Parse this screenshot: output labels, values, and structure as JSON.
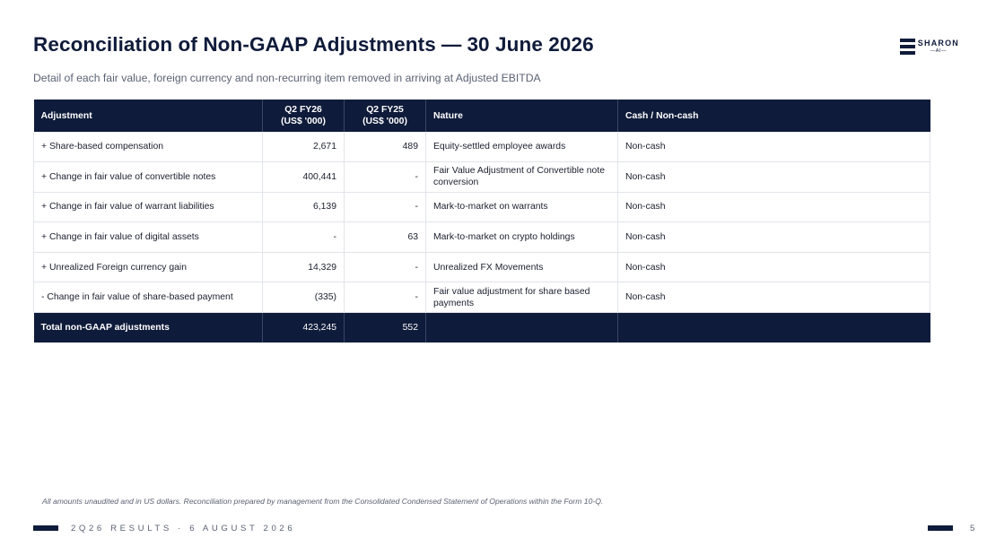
{
  "header": {
    "title_main": "Reconciliation of Non-GAAP Adjustments",
    "title_dash": "—",
    "title_date": "30 June 2026",
    "subtitle": "Detail of each fair value, foreign currency and non-recurring item removed in arriving at Adjusted EBITDA"
  },
  "logo": {
    "word": "SHARON",
    "sub": "—AI—"
  },
  "table": {
    "headers": {
      "adjustment": "Adjustment",
      "q2fy26_line1": "Q2 FY26",
      "q2fy26_line2": "(US$ '000)",
      "q2fy25_line1": "Q2 FY25",
      "q2fy25_line2": "(US$ '000)",
      "nature": "Nature",
      "cash": "Cash / Non-cash"
    },
    "rows": [
      {
        "adjustment": "+ Share-based compensation",
        "q2fy26": "2,671",
        "q2fy25": "489",
        "nature": "Equity-settled employee awards",
        "cash": "Non-cash"
      },
      {
        "adjustment": "+ Change in fair value of convertible notes",
        "q2fy26": "400,441",
        "q2fy25": "-",
        "nature": "Fair Value Adjustment of Convertible note conversion",
        "cash": "Non-cash"
      },
      {
        "adjustment": "+ Change in fair value of warrant liabilities",
        "q2fy26": "6,139",
        "q2fy25": "-",
        "nature": "Mark-to-market on warrants",
        "cash": "Non-cash"
      },
      {
        "adjustment": "+ Change in fair value of digital assets",
        "q2fy26": "-",
        "q2fy25": "63",
        "nature": "Mark-to-market on crypto holdings",
        "cash": "Non-cash"
      },
      {
        "adjustment": "+ Unrealized Foreign currency gain",
        "q2fy26": "14,329",
        "q2fy25": "-",
        "nature": "Unrealized FX Movements",
        "cash": "Non-cash"
      },
      {
        "adjustment": "- Change in fair value of share-based payment",
        "q2fy26": "(335)",
        "q2fy25": "-",
        "nature": "Fair value adjustment for share based payments",
        "cash": "Non-cash"
      }
    ],
    "total": {
      "adjustment": "Total non-GAAP adjustments",
      "q2fy26": "423,245",
      "q2fy25": "552",
      "nature": "",
      "cash": ""
    }
  },
  "footnote": "All amounts unaudited and in US dollars. Reconciliation prepared by management from the Consolidated Condensed Statement of Operations within the Form 10-Q.",
  "footer": {
    "text": "2Q26 RESULTS · 6 AUGUST 2026",
    "page_number": "5"
  }
}
